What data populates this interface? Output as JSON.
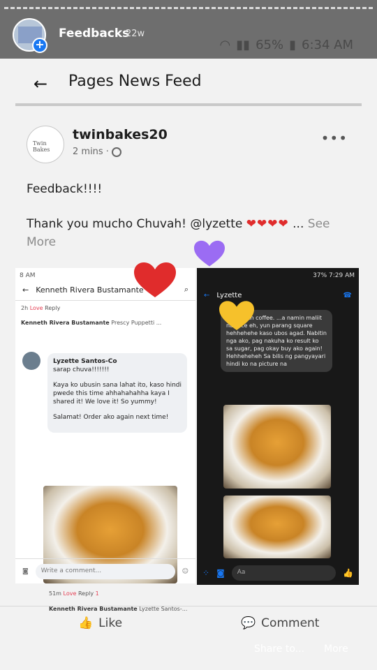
{
  "story": {
    "name": "Feedbacks",
    "time": "22w",
    "status": {
      "signal": "65%",
      "time": "6:34 AM"
    }
  },
  "nav": {
    "title": "Pages News Feed"
  },
  "post": {
    "page_name": "twinbakes20",
    "page_logo_text": "Twin Bakes",
    "time": "2 mins",
    "text1": "Feedback!!!!",
    "text2": "Thank you mucho Chuvah! @lyzette",
    "hearts": "❤❤❤❤",
    "ellipsis": "...",
    "see_more": "See More"
  },
  "left_shot": {
    "status": "8 AM",
    "header": "Kenneth Rivera Bustamante",
    "c1_time": "2h",
    "c1_love": "Love",
    "c1_reply": "Reply",
    "reply_name": "Kenneth Rivera Bustamante",
    "reply_tag": "Prescy Puppetti ...",
    "commenter": "Lyzette Santos-Co",
    "p1": "sarap chuva!!!!!!!",
    "p2": "Kaya ko ubusin sana lahat ito, kaso hindi pwede this time ahhahahahha kaya I shared it! We love it! So yummy!",
    "p3": "Salamat! Order ako again next time!",
    "c2_time": "51m",
    "c2_love": "Love",
    "c2_reply": "Reply",
    "c2_count": "1",
    "reply2_name": "Kenneth Rivera Bustamante",
    "reply2_tag": "Lyzette Santos-...",
    "write_placeholder": "Write a comment..."
  },
  "right_shot": {
    "status": "37% 7:29 AM",
    "name": "Lyzette",
    "msg": "...ect with coffee. ...a namin maliit na slice eh, yun parang square hehhehehe kaso ubos agad. Nabitin nga ako, pag nakuha ko result ko sa sugar, pag okay buy ako again! Hehheheheh Sa bilis ng pangyayari hindi ko na picture na",
    "input_placeholder": "Aa"
  },
  "actions": {
    "like": "Like",
    "comment": "Comment"
  },
  "footer": {
    "share": "Share to...",
    "more": "More"
  },
  "colors": {
    "accent": "#1877f2",
    "heart": "#e02c2c"
  }
}
